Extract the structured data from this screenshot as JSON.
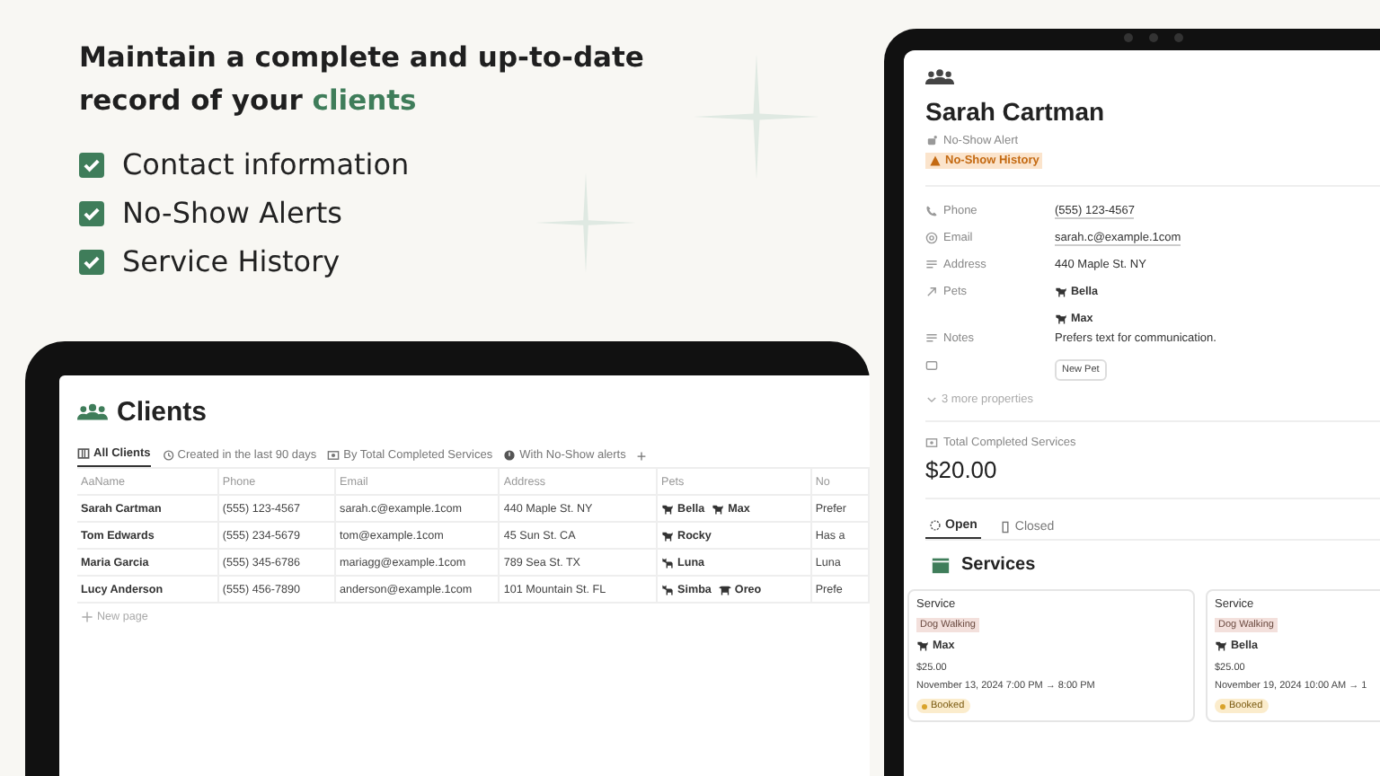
{
  "headline": {
    "text": "Maintain a complete and up-to-date record of your",
    "highlight": "clients"
  },
  "features": [
    {
      "label": "Contact information",
      "checked": true
    },
    {
      "label": "No-Show Alerts",
      "checked": true
    },
    {
      "label": "Service History",
      "checked": true
    }
  ],
  "clients_table": {
    "title": "Clients",
    "views": [
      {
        "label": "All Clients",
        "selected": true,
        "kind": "table"
      },
      {
        "label": "Created in the last 90 days",
        "selected": false,
        "kind": "history"
      },
      {
        "label": "By Total Completed Services",
        "selected": false,
        "kind": "money"
      },
      {
        "label": "With No-Show alerts",
        "selected": false,
        "kind": "alert"
      }
    ],
    "add_view": "+",
    "columns": [
      {
        "label": "Name",
        "prefix": "Aa",
        "kind": "title"
      },
      {
        "label": "Phone",
        "kind": "phone"
      },
      {
        "label": "Email",
        "kind": "email"
      },
      {
        "label": "Address",
        "kind": "text"
      },
      {
        "label": "Pets",
        "kind": "relation"
      },
      {
        "label": "No",
        "kind": "text"
      }
    ],
    "rows": [
      {
        "name": "Sarah Cartman",
        "phone": "(555) 123-4567",
        "email": "sarah.c@example.1com",
        "address": "440 Maple St. NY",
        "pets": [
          {
            "name": "Bella",
            "kind": "dog"
          },
          {
            "name": "Max",
            "kind": "dog"
          }
        ],
        "notes": "Prefer"
      },
      {
        "name": "Tom Edwards",
        "phone": "(555) 234-5679",
        "email": "tom@example.1com",
        "address": "45 Sun St. CA",
        "pets": [
          {
            "name": "Rocky",
            "kind": "dog"
          }
        ],
        "notes": "Has a"
      },
      {
        "name": "Maria Garcia",
        "phone": "(555) 345-6786",
        "email": "mariagg@example.1com",
        "address": "789 Sea St. TX",
        "pets": [
          {
            "name": "Luna",
            "kind": "cat"
          }
        ],
        "notes": "Luna"
      },
      {
        "name": "Lucy Anderson",
        "phone": "(555) 456-7890",
        "email": "anderson@example.1com",
        "address": "101 Mountain St. FL",
        "pets": [
          {
            "name": "Simba",
            "kind": "cat"
          },
          {
            "name": "Oreo",
            "kind": "other"
          }
        ],
        "notes": "Prefe"
      }
    ],
    "new_row": "New page"
  },
  "client_page": {
    "name": "Sarah Cartman",
    "alert_label": "No-Show Alert",
    "alert_tag": "No-Show History",
    "properties": [
      {
        "kind": "phone",
        "label": "Phone",
        "value": "(555) 123-4567"
      },
      {
        "kind": "email",
        "label": "Email",
        "value": "sarah.c@example.1com"
      },
      {
        "kind": "address",
        "label": "Address",
        "value": "440 Maple St. NY"
      },
      {
        "kind": "relation",
        "label": "Pets",
        "pets": [
          {
            "name": "Bella",
            "kind": "dog"
          },
          {
            "name": "Max",
            "kind": "dog"
          }
        ]
      },
      {
        "kind": "notes",
        "label": "Notes",
        "value": "Prefers text for communication."
      },
      {
        "kind": "button",
        "value": "New Pet"
      }
    ],
    "more_properties": "3 more properties",
    "total_label": "Total Completed Services",
    "total_value": "$20.00",
    "tabs": [
      {
        "label": "Open",
        "selected": true,
        "kind": "open"
      },
      {
        "label": "Closed",
        "selected": false,
        "kind": "closed"
      }
    ],
    "services_title": "Services",
    "services": [
      {
        "title": "Service",
        "type": "Dog Walking",
        "pet": {
          "name": "Max",
          "kind": "dog"
        },
        "price": "$25.00",
        "date": "November 13, 2024 7:00 PM → 8:00 PM",
        "status": "Booked"
      },
      {
        "title": "Service",
        "type": "Dog Walking",
        "pet": {
          "name": "Bella",
          "kind": "dog"
        },
        "price": "$25.00",
        "date": "November 19, 2024 10:00 AM → 1",
        "status": "Booked"
      }
    ]
  }
}
